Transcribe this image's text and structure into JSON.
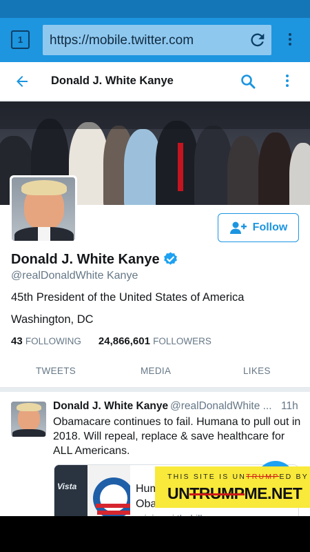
{
  "browser": {
    "tab_count": "1",
    "url": "https://mobile.twitter.com"
  },
  "header": {
    "title": "Donald J. White Kanye"
  },
  "profile": {
    "name": "Donald J. White Kanye",
    "handle": "@realDonaldWhite Kanye",
    "bio": "45th President of the United States of America",
    "location": "Washington, DC",
    "following_count": "43",
    "following_label": "FOLLOWING",
    "followers_count": "24,866,601",
    "followers_label": "FOLLOWERS",
    "follow_label": "Follow"
  },
  "tabs": [
    "TWEETS",
    "MEDIA",
    "LIKES"
  ],
  "tweet": {
    "name": "Donald J. White Kanye",
    "handle": "@realDonaldWhite ...",
    "time": "11h",
    "text": "Obamacare continues to fail. Humana to pull out in 2018. Will repeal, replace & save healthcare for ALL Americans.",
    "card": {
      "title": "Hum",
      "subtitle": "Oba",
      "url": "origin.nyi.thehill.com",
      "image_text": "Vista"
    }
  },
  "ad": {
    "top_prefix": "THIS SITE IS UN",
    "top_strike": "TRUMP",
    "top_suffix": "ED BY",
    "main_prefix": "UN",
    "main_strike": "TRUMP",
    "main_suffix": "ME.NET"
  },
  "colors": {
    "browser_bar": "#1e95df",
    "status_bar": "#1476b7",
    "twitter_blue": "#1b95e0",
    "ad_yellow": "#f8e93a",
    "ad_strike_red": "#d01818"
  }
}
